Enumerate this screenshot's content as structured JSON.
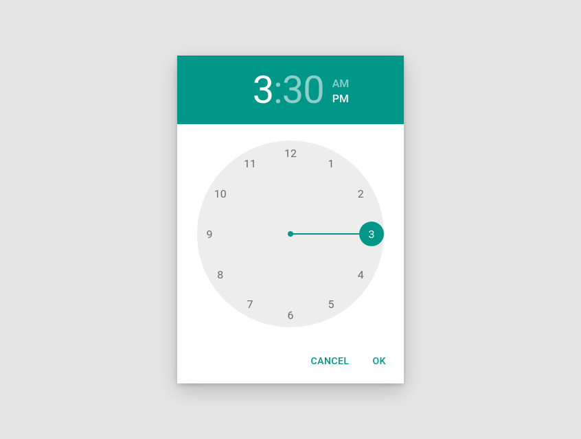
{
  "colors": {
    "accent": "#009688",
    "clock_face": "#ededed",
    "page_bg": "#e6e6e6"
  },
  "header": {
    "hour": "3",
    "colon": ":",
    "minute": "30",
    "am_label": "AM",
    "pm_label": "PM",
    "selected_period": "PM",
    "editing": "hour"
  },
  "clock": {
    "numbers": [
      "12",
      "1",
      "2",
      "3",
      "4",
      "5",
      "6",
      "7",
      "8",
      "9",
      "10",
      "11"
    ],
    "selected_hour": 3,
    "radius_px": 118,
    "face_size_px": 272
  },
  "actions": {
    "cancel_label": "CANCEL",
    "ok_label": "OK"
  }
}
